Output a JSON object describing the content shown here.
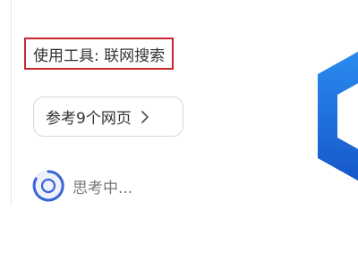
{
  "tool_status": {
    "label": "使用工具: 联网搜索",
    "highlight_color": "#c8262c"
  },
  "references": {
    "label": "参考9个网页",
    "icon": "chevron-right-icon"
  },
  "status": {
    "text": "思考中...",
    "icon": "loading-spinner-icon"
  },
  "logo": {
    "icon": "hexagon-logo-icon",
    "color": "#1f6fe6"
  }
}
